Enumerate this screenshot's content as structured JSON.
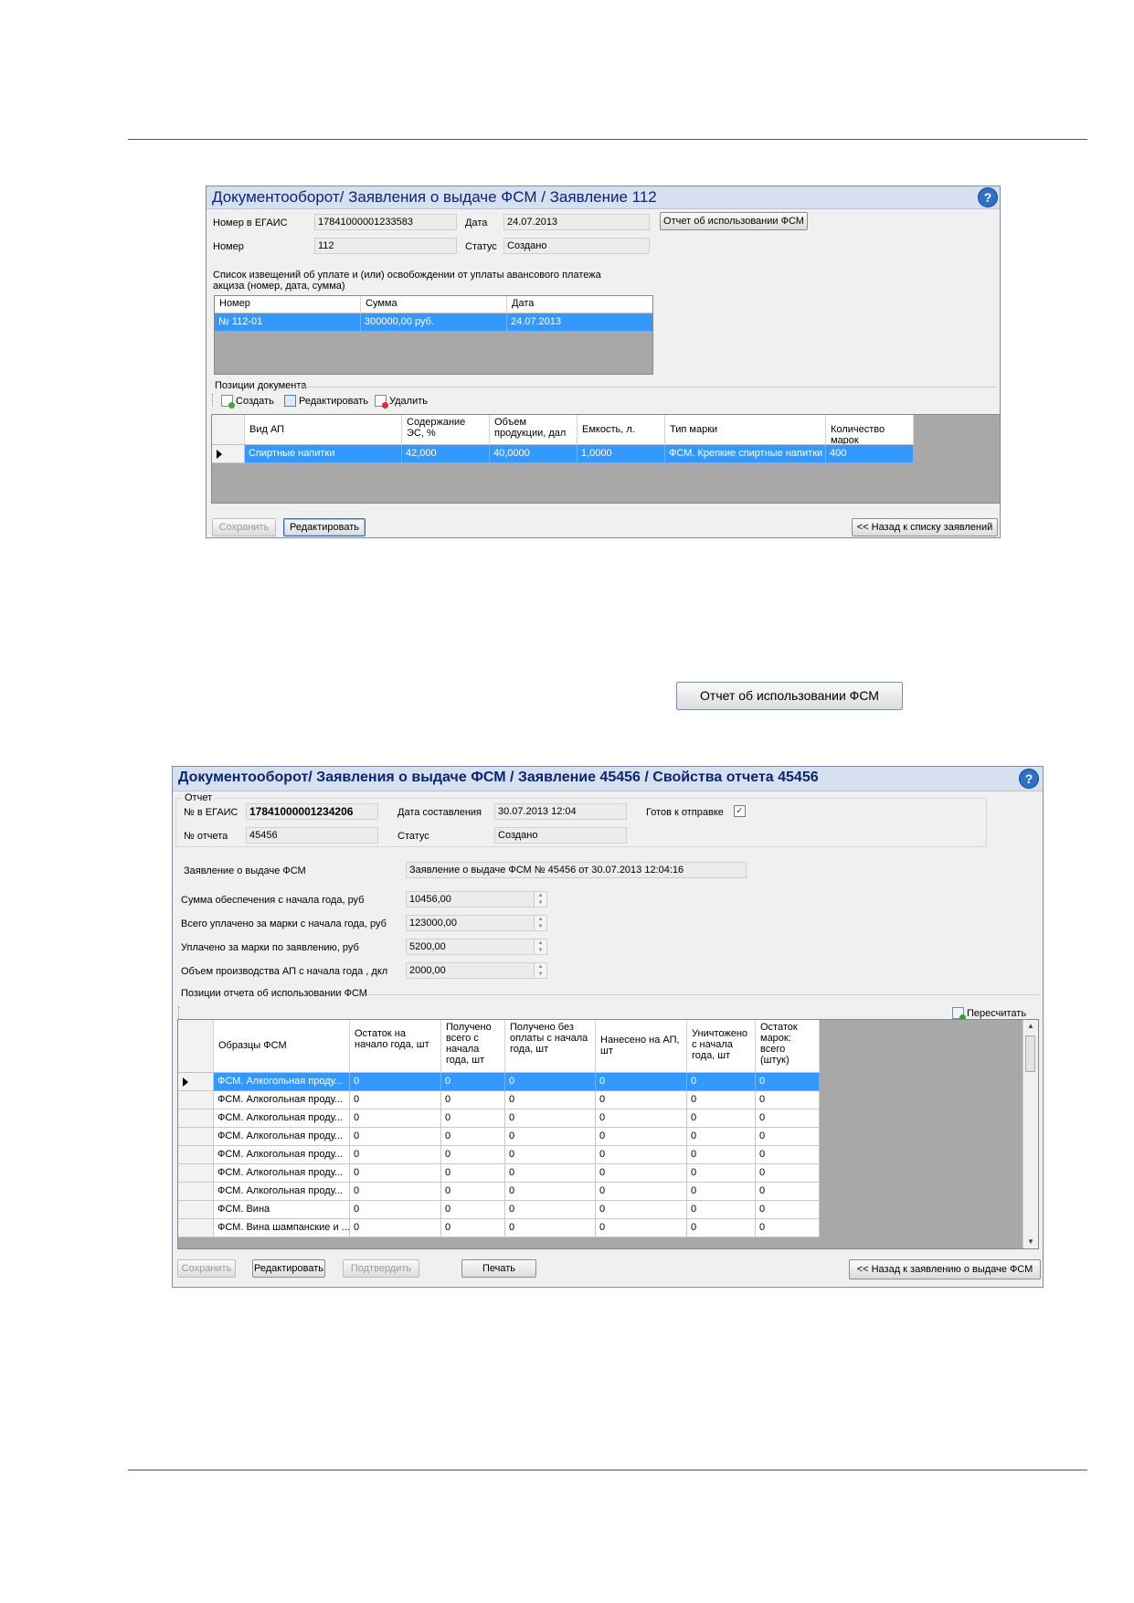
{
  "app1": {
    "title": "Документооборот/ Заявления о выдаче ФСМ / Заявление 112",
    "help": "?",
    "labels": {
      "egais": "Номер в ЕГАИС",
      "number": "Номер",
      "date": "Дата",
      "status": "Статус"
    },
    "values": {
      "egais": "17841000001233583",
      "number": "112",
      "date": "24.07.2013",
      "status": "Создано"
    },
    "report_button": "Отчет об использовании ФСМ",
    "notices_caption": "Список извещений об уплате и (или) освобождении от уплаты авансового платежа акциза (номер, дата, сумма)",
    "notices_headers": [
      "Номер",
      "Сумма",
      "Дата"
    ],
    "notices_rows": [
      [
        "№ 112-01",
        "300000,00 руб.",
        "24.07.2013"
      ]
    ],
    "positions_caption": "Позиции документа",
    "toolbar": {
      "create": "Создать",
      "edit": "Редактировать",
      "delete": "Удалить"
    },
    "positions_headers": [
      "Вид АП",
      "Содержание ЭС, %",
      "Объем продукции, дал",
      "Емкость, л.",
      "Тип марки",
      "Количество марок"
    ],
    "positions_rows": [
      [
        "Спиртные напитки",
        "42,000",
        "40,0000",
        "1,0000",
        "ФСМ. Крепкие спиртные напитки д...",
        "400"
      ]
    ],
    "buttons": {
      "save": "Сохранить",
      "edit": "Редактировать",
      "back": "<< Назад к списку заявлений"
    }
  },
  "standalone_button": "Отчет об использовании ФСМ",
  "app2": {
    "title": "Документооборот/ Заявления о выдаче ФСМ / Заявление 45456 / Свойства отчета 45456",
    "help": "?",
    "group_caption": "Отчет",
    "labels": {
      "egais": "№ в ЕГАИС",
      "report_no": "№ отчета",
      "compose_date": "Дата составления",
      "status": "Статус",
      "ready": "Готов к отправке",
      "application": "Заявление о выдаче ФСМ"
    },
    "values": {
      "egais": "17841000001234206",
      "report_no": "45456",
      "compose_date": "30.07.2013 12:04",
      "status": "Создано",
      "ready_checked": true,
      "application": "Заявление о выдаче ФСМ № 45456 от 30.07.2013 12:04:16"
    },
    "amounts": [
      {
        "label": "Сумма обеспечения с начала года, руб",
        "value": "10456,00"
      },
      {
        "label": "Всего уплачено  за  марки  с  начала года, руб",
        "value": "123000,00"
      },
      {
        "label": "Уплачено за марки по заявлению, руб",
        "value": "5200,00"
      },
      {
        "label": "Объем производства АП с начала года , дкл",
        "value": "2000,00"
      }
    ],
    "positions_caption": "Позиции отчета об использовании ФСМ",
    "recalc": "Пересчитать",
    "headers": [
      "Образцы ФСМ",
      "Остаток на начало года, шт",
      "Получено всего с начала года, шт",
      "Получено без оплаты с начала года, шт",
      "Нанесено на АП, шт",
      "Уничтожено с начала года, шт",
      "Остаток марок: всего (штук)"
    ],
    "rows": [
      [
        "ФСМ. Алкогольная проду...",
        "0",
        "0",
        "0",
        "0",
        "0",
        "0"
      ],
      [
        "ФСМ. Алкогольная проду...",
        "0",
        "0",
        "0",
        "0",
        "0",
        "0"
      ],
      [
        "ФСМ. Алкогольная проду...",
        "0",
        "0",
        "0",
        "0",
        "0",
        "0"
      ],
      [
        "ФСМ. Алкогольная проду...",
        "0",
        "0",
        "0",
        "0",
        "0",
        "0"
      ],
      [
        "ФСМ. Алкогольная проду...",
        "0",
        "0",
        "0",
        "0",
        "0",
        "0"
      ],
      [
        "ФСМ. Алкогольная проду...",
        "0",
        "0",
        "0",
        "0",
        "0",
        "0"
      ],
      [
        "ФСМ. Алкогольная проду...",
        "0",
        "0",
        "0",
        "0",
        "0",
        "0"
      ],
      [
        "ФСМ. Вина",
        "0",
        "0",
        "0",
        "0",
        "0",
        "0"
      ],
      [
        "ФСМ. Вина шампанские и ...",
        "0",
        "0",
        "0",
        "0",
        "0",
        "0"
      ]
    ],
    "buttons": {
      "save": "Сохранить",
      "edit": "Редактировать",
      "confirm": "Подтвердить",
      "print": "Печать",
      "back": "<< Назад к заявлению о выдаче ФСМ"
    }
  }
}
